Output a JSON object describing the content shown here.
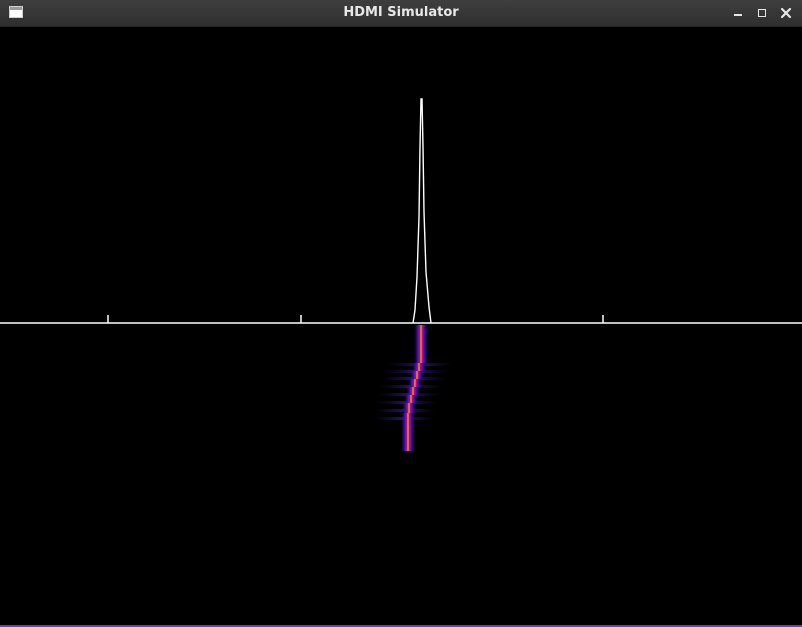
{
  "window": {
    "title": "HDMI Simulator",
    "icons": {
      "app": "window-icon",
      "minimize": "minimize-icon",
      "maximize": "maximize-icon",
      "close": "close-icon"
    }
  },
  "colors": {
    "titlebar": "#333333",
    "background": "#000000",
    "trace": "#ffffff",
    "heat_low": "#2a0a8a",
    "heat_mid": "#c0178c",
    "heat_high": "#ff8a00",
    "heat_peak": "#fff25a"
  }
}
